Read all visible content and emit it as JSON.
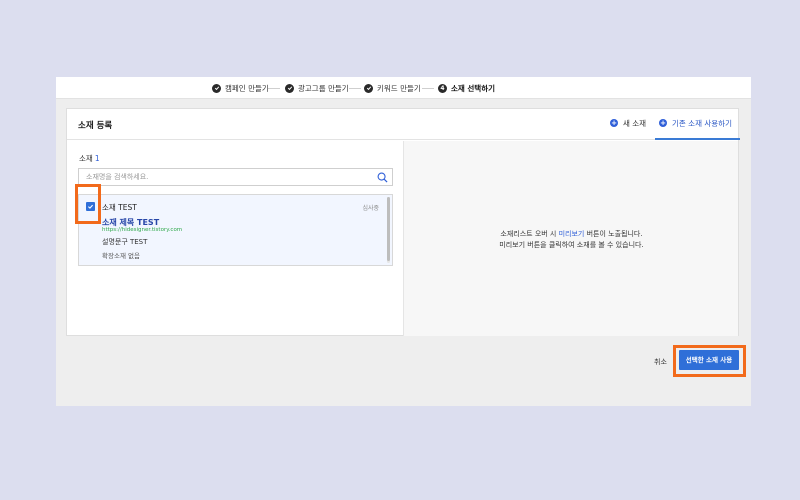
{
  "steps": [
    {
      "label": "캠페인 만들기",
      "state": "done"
    },
    {
      "label": "광고그룹 만들기",
      "state": "done"
    },
    {
      "label": "키워드 만들기",
      "state": "done"
    },
    {
      "label": "소재 선택하기",
      "state": "current",
      "number": "4"
    }
  ],
  "panel": {
    "title": "소재 등록",
    "tabs": [
      {
        "label": "새 소재",
        "active": false
      },
      {
        "label": "기존 소재 사용하기",
        "active": true
      }
    ]
  },
  "list": {
    "count_label": "소재",
    "count": "1",
    "search_placeholder": "소재명을 검색하세요.",
    "item": {
      "checked": true,
      "name": "소재 TEST",
      "status": "심사중",
      "headline": "소재 제목 TEST",
      "url": "https://hidesigner.tistory.com",
      "description": "설명문구 TEST",
      "extension": "확장소재 없음"
    }
  },
  "preview": {
    "line1_prefix": "소재리스트 오버 시 ",
    "line1_highlight": "미리보기",
    "line1_suffix": " 버튼이 노출됩니다.",
    "line2": "미리보기 버튼을 클릭하여 소재를 볼 수 있습니다."
  },
  "footer": {
    "cancel_label": "취소",
    "submit_label": "선택한 소재 사용"
  },
  "colors": {
    "accent": "#2f6fd8",
    "highlight": "#f26a1b",
    "url": "#2ea84a"
  }
}
